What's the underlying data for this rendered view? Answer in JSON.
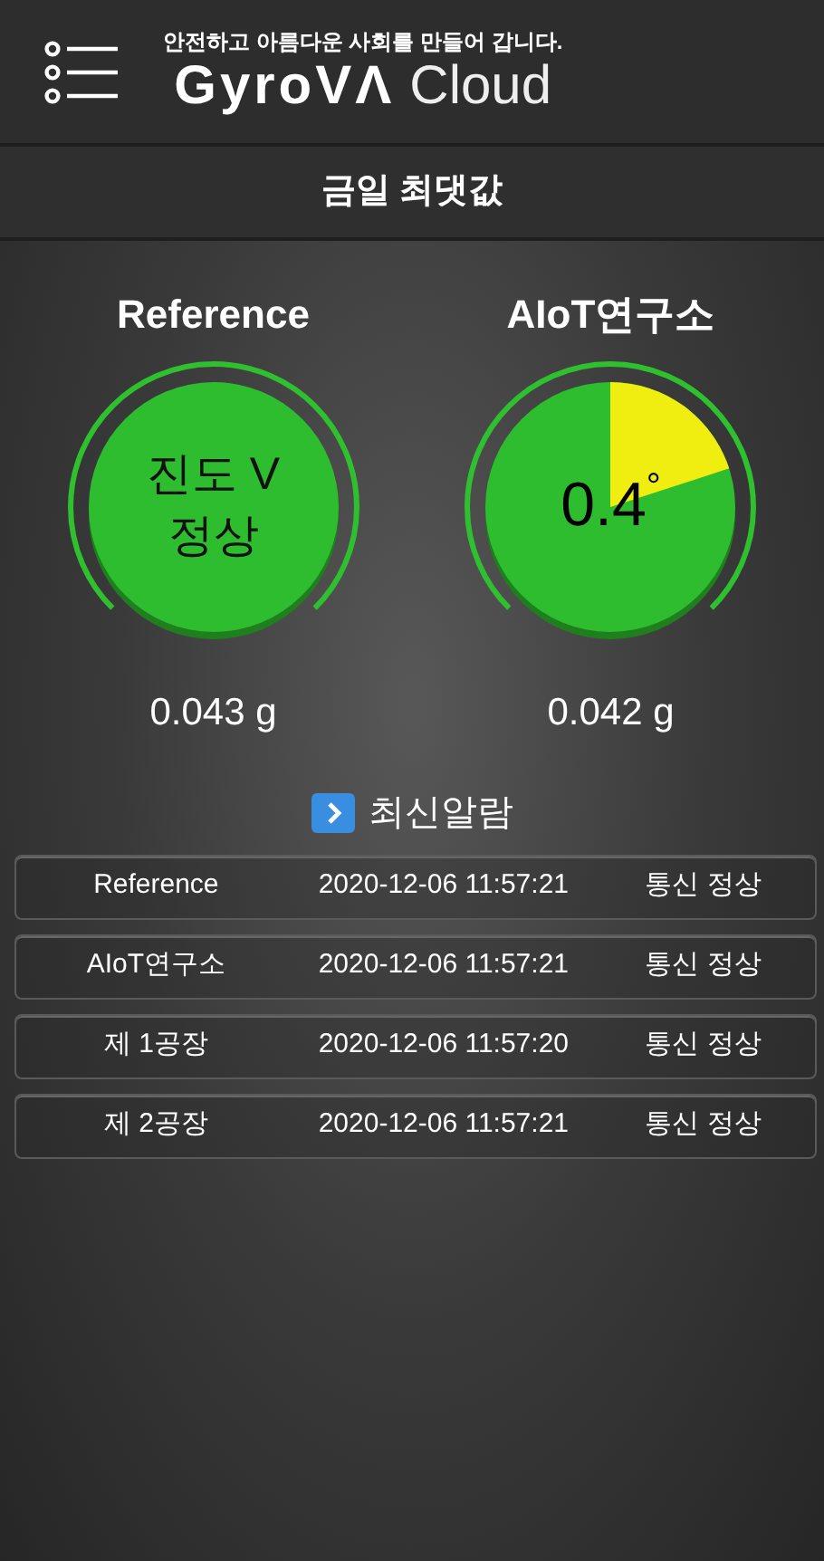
{
  "header": {
    "slogan": "안전하고 아름다운 사회를 만들어 갑니다.",
    "logo_bold": "GyroVΛ",
    "logo_light": "Cloud"
  },
  "section_title": "금일 최댓값",
  "gauges": [
    {
      "name": "Reference",
      "kind": "text",
      "lines": [
        "진도 V",
        "정상"
      ],
      "reading": "0.043 g"
    },
    {
      "name": "AIoT연구소",
      "kind": "pie",
      "value": "0.4",
      "unit": "°",
      "reading": "0.042 g"
    }
  ],
  "alarms": {
    "title": "최신알람",
    "rows": [
      {
        "site": "Reference",
        "time": "2020-12-06 11:57:21",
        "status": "통신 정상"
      },
      {
        "site": "AIoT연구소",
        "time": "2020-12-06 11:57:21",
        "status": "통신 정상"
      },
      {
        "site": "제 1공장",
        "time": "2020-12-06 11:57:20",
        "status": "통신 정상"
      },
      {
        "site": "제 2공장",
        "time": "2020-12-06 11:57:21",
        "status": "통신 정상"
      }
    ]
  }
}
